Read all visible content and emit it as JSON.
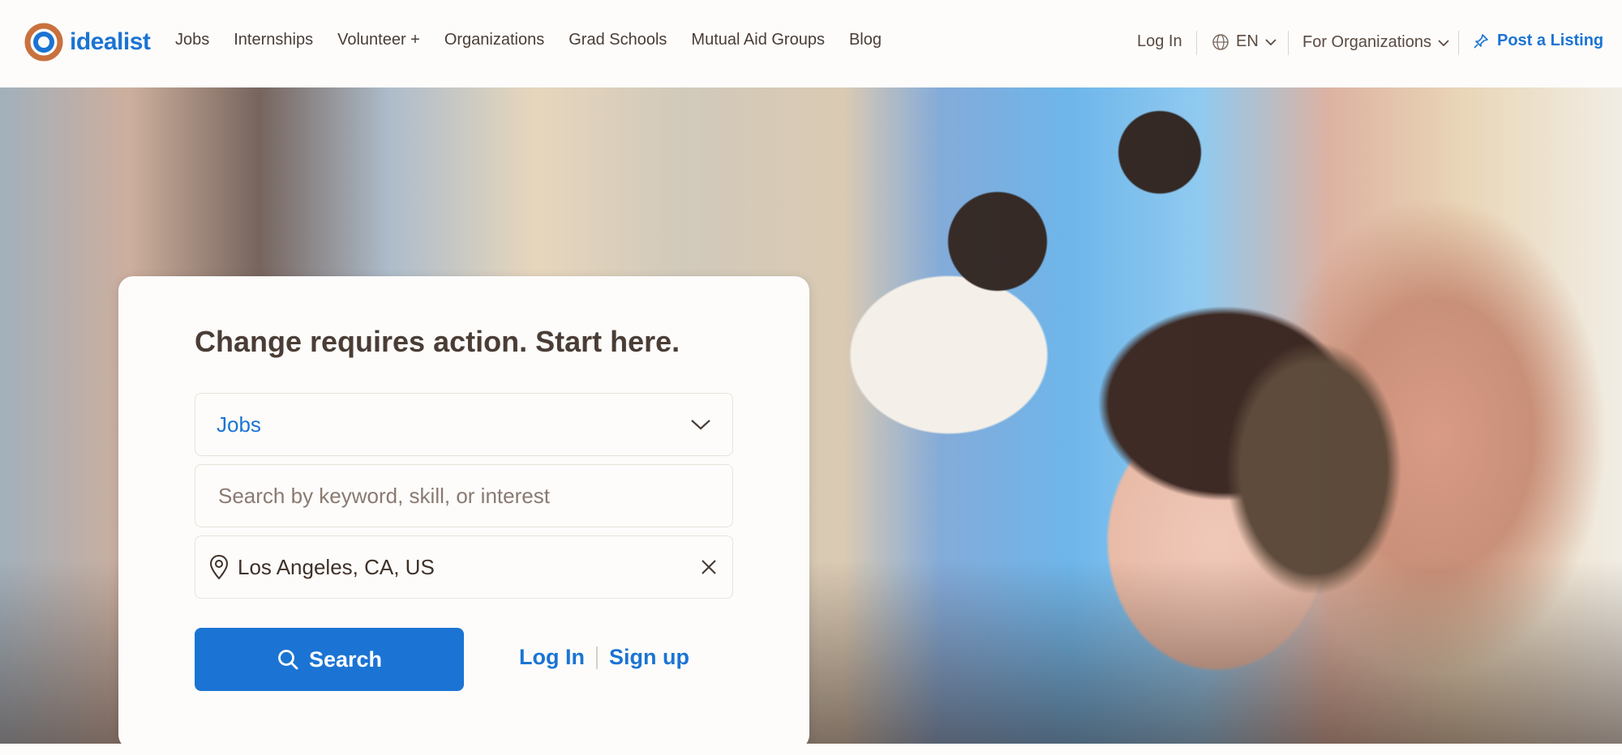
{
  "brand": {
    "name": "idealist"
  },
  "nav": {
    "items": [
      {
        "label": "Jobs"
      },
      {
        "label": "Internships"
      },
      {
        "label": "Volunteer +"
      },
      {
        "label": "Organizations"
      },
      {
        "label": "Grad Schools"
      },
      {
        "label": "Mutual Aid Groups"
      },
      {
        "label": "Blog"
      }
    ]
  },
  "header_right": {
    "login": "Log In",
    "language": "EN",
    "for_orgs": "For Organizations",
    "post_listing": "Post a Listing"
  },
  "search_card": {
    "title": "Change requires action. Start here.",
    "type_value": "Jobs",
    "keyword_placeholder": "Search by keyword, skill, or interest",
    "keyword_value": "",
    "location_value": "Los Angeles, CA, US",
    "search_label": "Search",
    "login_label": "Log In",
    "signup_label": "Sign up"
  },
  "colors": {
    "accent": "#1b74d3",
    "text": "#4a3d35",
    "background": "#fdfcfb"
  },
  "icons": [
    "globe-icon",
    "chevron-down-icon",
    "pin-icon",
    "location-icon",
    "close-icon",
    "search-icon"
  ]
}
